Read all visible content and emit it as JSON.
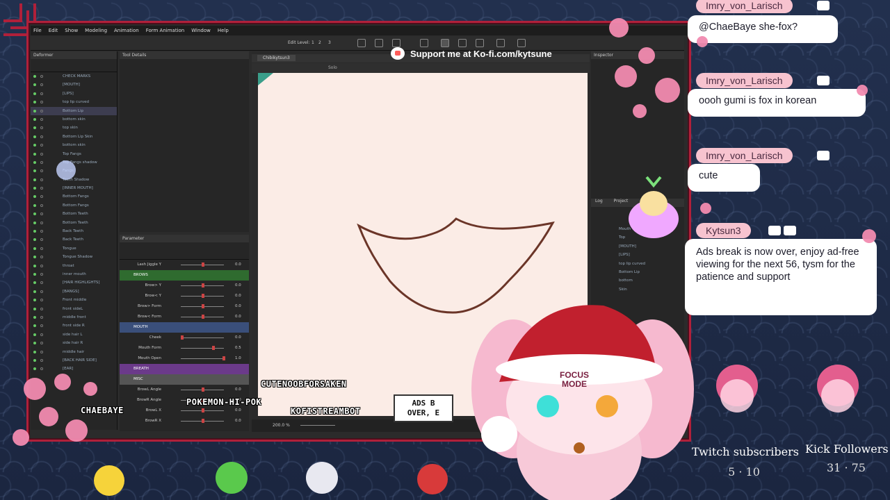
{
  "app": {
    "menu": [
      "File",
      "Edit",
      "Show",
      "Modeling",
      "Animation",
      "Form Animation",
      "Window",
      "Help"
    ],
    "edit_level_label": "Edit Level:",
    "edit_levels": [
      "1",
      "2",
      "3"
    ],
    "deformer_title": "Deformer",
    "tool_details_title": "Tool Details",
    "parameter_title": "Parameter",
    "inspector_title": "Inspector",
    "canvas_tab": "Chibikytsun3",
    "solo_label": "Solo",
    "zoom": "200.0 %",
    "log_tab": "Log",
    "project_tab": "Project",
    "layers": [
      "CHECK MARKS",
      "[MOUTH]",
      "[LIPS]",
      "top lip curved",
      "Bottom Lip",
      "bottom skin",
      "top skin",
      "Bottom Lip Skin",
      "bottom skin",
      "Top Fangs",
      "Top Fangs shadow",
      "Fangs",
      "Teeth Shadow",
      "[INNER MOUTH]",
      "Bottom Fangs",
      "Bottom Fangs",
      "Bottom Teeth",
      "Bottom Teeth",
      "Back Teeth",
      "Back Teeth",
      "Tongue",
      "Tongue Shadow",
      "throat",
      "inner mouth",
      "[HAIR HIGHLIGHTS]",
      "[BANGS]",
      "Front middle",
      "front sideL",
      "middle front",
      "front side R",
      "side hair L",
      "side hair R",
      "middle hair",
      "[BACK HAIR SIDE]",
      "[EAR]"
    ],
    "selected_layer_index": 4,
    "params": [
      {
        "type": "param",
        "label": "Lash Jiggle Y",
        "value": "0.0",
        "pos": 0.5
      },
      {
        "type": "group",
        "label": "BROWS",
        "color": "#2f6b2f"
      },
      {
        "type": "param",
        "label": "Brow> Y",
        "value": "0.0",
        "pos": 0.5
      },
      {
        "type": "param",
        "label": "Brow< Y",
        "value": "0.0",
        "pos": 0.5
      },
      {
        "type": "param",
        "label": "Brow> Form",
        "value": "0.0",
        "pos": 0.5
      },
      {
        "type": "param",
        "label": "Brow< Form",
        "value": "0.0",
        "pos": 0.5
      },
      {
        "type": "group",
        "label": "MOUTH",
        "color": "#3a4f7a"
      },
      {
        "type": "param",
        "label": "Cheek",
        "value": "0.0",
        "pos": 0.0
      },
      {
        "type": "param",
        "label": "Mouth Form",
        "value": "0.5",
        "pos": 0.75
      },
      {
        "type": "param",
        "label": "Mouth Open",
        "value": "1.0",
        "pos": 1.0
      },
      {
        "type": "group",
        "label": "BREATH",
        "color": "#6b3a8a"
      },
      {
        "type": "group",
        "label": "MISC",
        "color": "#555555"
      },
      {
        "type": "param",
        "label": "BrowL Angle",
        "value": "0.0",
        "pos": 0.5
      },
      {
        "type": "param",
        "label": "BrowR Angle",
        "value": "0.0",
        "pos": 0.5
      },
      {
        "type": "param",
        "label": "BrowL X",
        "value": "0.0",
        "pos": 0.5
      },
      {
        "type": "param",
        "label": "BrowR X",
        "value": "0.0",
        "pos": 0.5
      }
    ],
    "inspector_layers": [
      "Mouth",
      "Top",
      "[MOUTH]",
      "[LIPS]",
      "top lip curved",
      "Bottom Lip",
      "bottom",
      "Skin"
    ]
  },
  "banner": {
    "kofi_text": "Support me at Ko-fi.com/kytsune"
  },
  "chat": [
    {
      "user": "Imry_von_Larisch",
      "text": "@ChaeBaye she-fox?"
    },
    {
      "user": "Imry_von_Larisch",
      "text": "oooh gumi is fox in korean"
    },
    {
      "user": "Imry_von_Larisch",
      "text": "cute"
    },
    {
      "user": "Kytsun3",
      "text": "Ads break is now over, enjoy ad-free viewing for the next 56, tysm for the patience and support"
    }
  ],
  "stream_names": {
    "n1": "CUTENOOBFORSAKEN",
    "n2": "POKEMON-HI-POK",
    "n3": "KOFISTREAMBOT",
    "n4": "CHAEBAYE",
    "ads_line1": "ADS B",
    "ads_line2": "OVER, E"
  },
  "mascot": {
    "sign": "FOCUS MODE"
  },
  "stats": {
    "twitch_label": "Twitch subscribers",
    "twitch_value": "5 · 10",
    "kick_label": "Kick Followers",
    "kick_value": "31 · 75"
  },
  "colors": {
    "frame": "#b0203a",
    "bubble_name": "#f7c3cf",
    "canvas": "#fbece6",
    "lip_line": "#6b3528"
  }
}
